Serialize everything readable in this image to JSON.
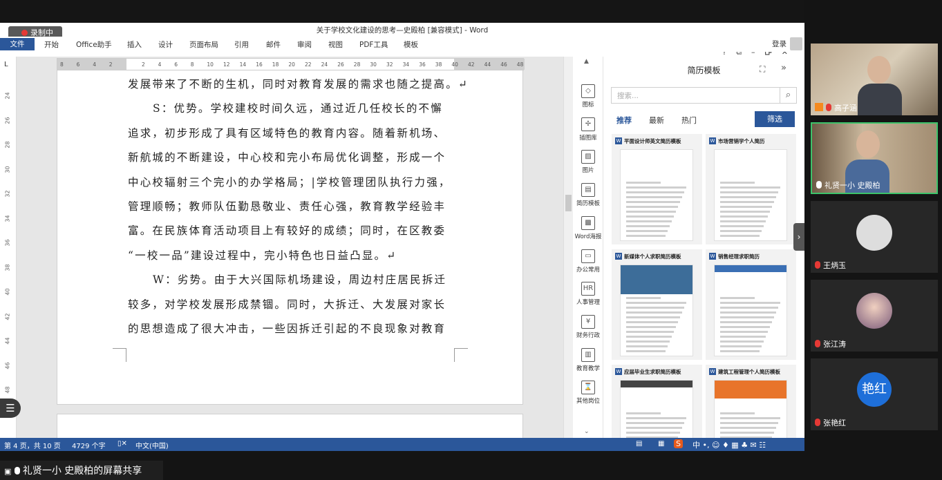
{
  "word": {
    "title": "关于学校文化建设的思考—史殿柏 [兼容模式] - Word",
    "recording": "录制中",
    "window_controls": [
      "?",
      "⧉",
      "–",
      "🗗",
      "✕"
    ],
    "menu": [
      "文件",
      "开始",
      "Office助手",
      "插入",
      "设计",
      "页面布局",
      "引用",
      "邮件",
      "审阅",
      "视图",
      "PDF工具",
      "模板"
    ],
    "login": "登录",
    "ruler_ticks": [
      "8",
      "6",
      "4",
      "2",
      "",
      "2",
      "4",
      "6",
      "8",
      "10",
      "12",
      "14",
      "16",
      "18",
      "20",
      "22",
      "24",
      "26",
      "28",
      "30",
      "32",
      "34",
      "36",
      "38",
      "40",
      "42",
      "44",
      "46",
      "48"
    ],
    "vruler_ticks": [
      "24",
      "26",
      "28",
      "30",
      "32",
      "34",
      "36",
      "38",
      "40",
      "42",
      "44",
      "46",
      "48"
    ],
    "doc_lines": [
      "发展带来了不断的生机，同时对教育发展的需求也随之提高。↵",
      "S：优势。学校建校时间久远，通过近几任校长的不懈",
      "追求，初步形成了具有区域特色的教育内容。随着新机场、",
      "新航城的不断建设，中心校和完小布局优化调整，形成一个",
      "中心校辐射三个完小的办学格局；|学校管理团队执行力强，",
      "管理顺畅；教师队伍勤恳敬业、责任心强，教育教学经验丰",
      "富。在民族体育活动项目上有较好的成绩；同时，在区教委",
      "“一校一品”建设过程中，完小特色也日益凸显。↵",
      "W：劣势。由于大兴国际机场建设，周边村庄居民拆迁",
      "较多，对学校发展形成禁锢。同时，大拆迁、大发展对家长",
      "的思想造成了很大冲击，一些因拆迁引起的不良现象对教育"
    ]
  },
  "iconbar": [
    {
      "label": "图标",
      "icon": "shapes-icon"
    },
    {
      "label": "插图库",
      "icon": "windmill-icon"
    },
    {
      "label": "图片",
      "icon": "image-icon"
    },
    {
      "label": "简历模板",
      "icon": "resume-icon"
    },
    {
      "label": "Word海报",
      "icon": "poster-icon"
    },
    {
      "label": "办公常用",
      "icon": "briefcase-icon"
    },
    {
      "label": "人事管理",
      "icon": "hr-icon"
    },
    {
      "label": "财务行政",
      "icon": "yen-icon"
    },
    {
      "label": "教育教学",
      "icon": "book-icon"
    },
    {
      "label": "其他岗位",
      "icon": "hourglass-icon"
    }
  ],
  "panel": {
    "title": "简历模板",
    "search_placeholder": "搜索...",
    "tabs": [
      "推荐",
      "最新",
      "热门"
    ],
    "filter": "筛选",
    "cards": [
      "平面设计师英文简历模板",
      "市场营销学个人简历",
      "新媒体个人求职简历模板",
      "销售经理求职简历",
      "应届毕业生求职简历模板",
      "建筑工程管理个人简历模板"
    ]
  },
  "status": {
    "page": "第 4 页，共 10 页",
    "words": "4729 个字",
    "lang": "中文(中国)"
  },
  "share_label": "礼贤一小 史殿柏的屏幕共享",
  "participants": [
    {
      "name": "高子涵",
      "type": "video"
    },
    {
      "name": "礼贤一小 史殿柏",
      "type": "video"
    },
    {
      "name": "王炳玉",
      "type": "avatar"
    },
    {
      "name": "张江涛",
      "type": "photo"
    },
    {
      "name": "张艳红",
      "type": "text",
      "avatar_text": "艳红"
    }
  ],
  "colors": {
    "word_blue": "#2b579a",
    "active_border": "#3cc36a",
    "avatar_blue": "#1e6fd9"
  }
}
